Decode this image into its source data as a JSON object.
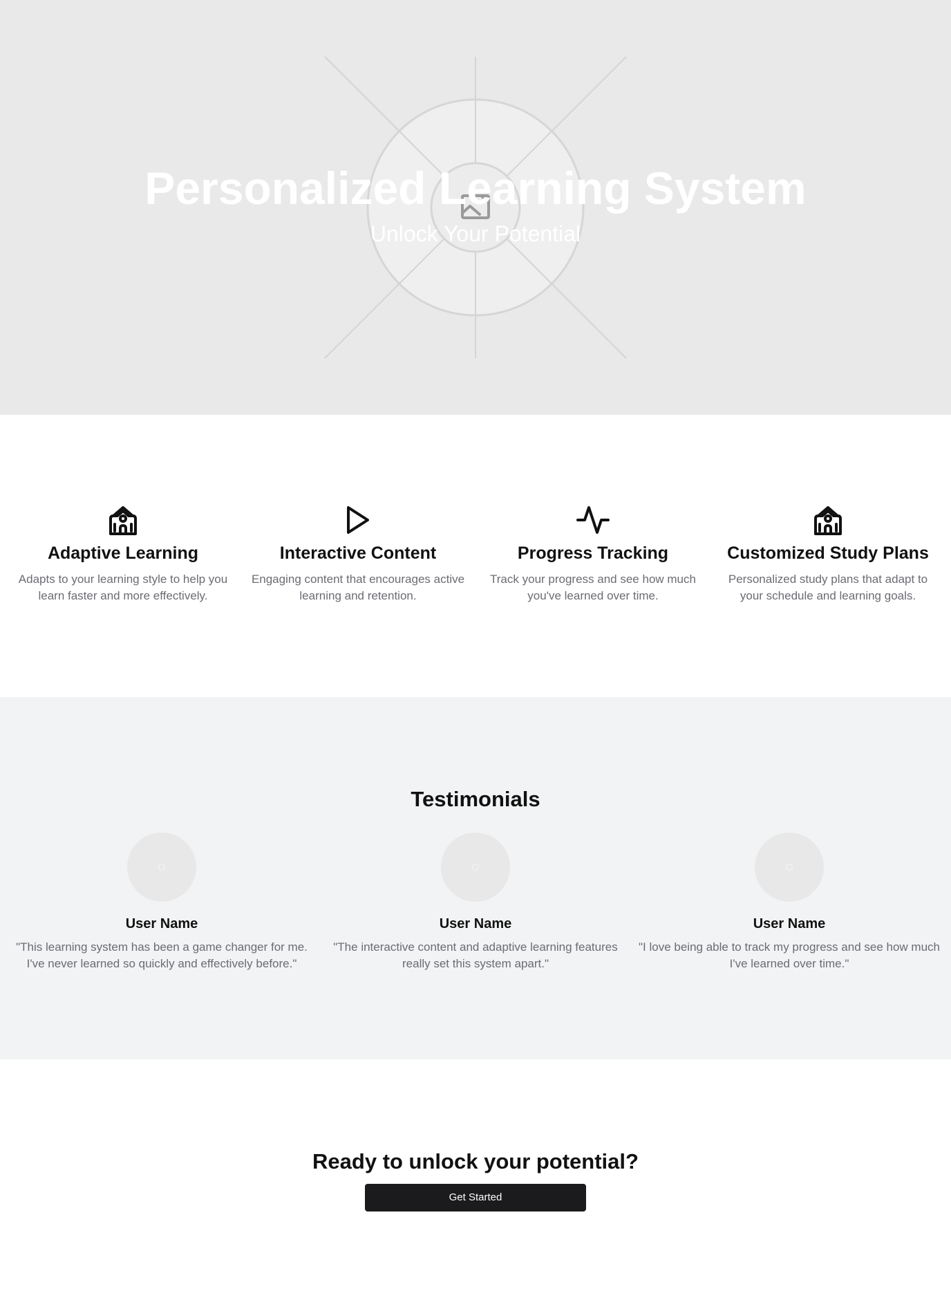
{
  "hero": {
    "title": "Personalized Learning System",
    "subtitle": "Unlock Your Potential",
    "image_placeholder_icon": "image-icon"
  },
  "features": [
    {
      "icon": "school-icon",
      "title": "Adaptive Learning",
      "description": "Adapts to your learning style to help you learn faster and more effectively."
    },
    {
      "icon": "play-icon",
      "title": "Interactive Content",
      "description": "Engaging content that encourages active learning and retention."
    },
    {
      "icon": "activity-icon",
      "title": "Progress Tracking",
      "description": "Track your progress and see how much you've learned over time."
    },
    {
      "icon": "school-icon",
      "title": "Customized Study Plans",
      "description": "Personalized study plans that adapt to your schedule and learning goals."
    }
  ],
  "testimonials": {
    "heading": "Testimonials",
    "items": [
      {
        "name": "User Name",
        "quote": "\"This learning system has been a game changer for me. I've never learned so quickly and effectively before.\""
      },
      {
        "name": "User Name",
        "quote": "\"The interactive content and adaptive learning features really set this system apart.\""
      },
      {
        "name": "User Name",
        "quote": "\"I love being able to track my progress and see how much I've learned over time.\""
      }
    ]
  },
  "cta": {
    "heading": "Ready to unlock your potential?",
    "button_label": "Get Started"
  },
  "colors": {
    "hero_bg": "#e9e9e9",
    "testimonials_bg": "#f2f3f4",
    "button_bg": "#1b1b1d",
    "muted_text": "#6b6b74"
  }
}
